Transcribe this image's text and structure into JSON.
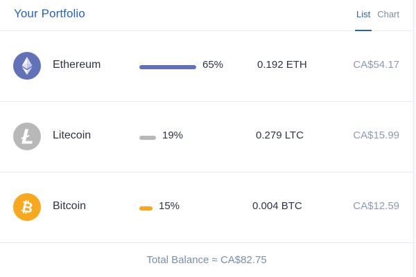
{
  "header": {
    "title": "Your Portfolio",
    "tabs": [
      {
        "label": "List",
        "active": true
      },
      {
        "label": "Chart",
        "active": false
      }
    ]
  },
  "assets": [
    {
      "name": "Ethereum",
      "icon": "ethereum-icon",
      "color": "#6272b8",
      "percent_label": "65%",
      "percent": 65,
      "amount": "0.192 ETH",
      "value": "CA$54.17"
    },
    {
      "name": "Litecoin",
      "icon": "litecoin-icon",
      "color": "#b8b8b8",
      "percent_label": "19%",
      "percent": 19,
      "amount": "0.279 LTC",
      "value": "CA$15.99"
    },
    {
      "name": "Bitcoin",
      "icon": "bitcoin-icon",
      "color": "#f7a81c",
      "percent_label": "15%",
      "percent": 15,
      "amount": "0.004 BTC",
      "value": "CA$12.59"
    }
  ],
  "footer": {
    "total_label": "Total Balance ≈ CA$82.75"
  }
}
